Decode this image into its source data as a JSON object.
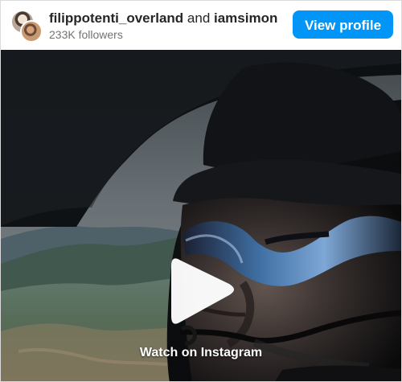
{
  "header": {
    "account_primary": "filippotenti_overland",
    "joiner": " and ",
    "account_secondary": "iamsimon",
    "followers": "233K followers",
    "view_profile_label": "View profile"
  },
  "media": {
    "watch_label": "Watch on Instagram",
    "play_icon": "play-icon"
  },
  "colors": {
    "accent": "#0095f6",
    "text_primary": "#262626",
    "text_secondary": "#737373"
  }
}
